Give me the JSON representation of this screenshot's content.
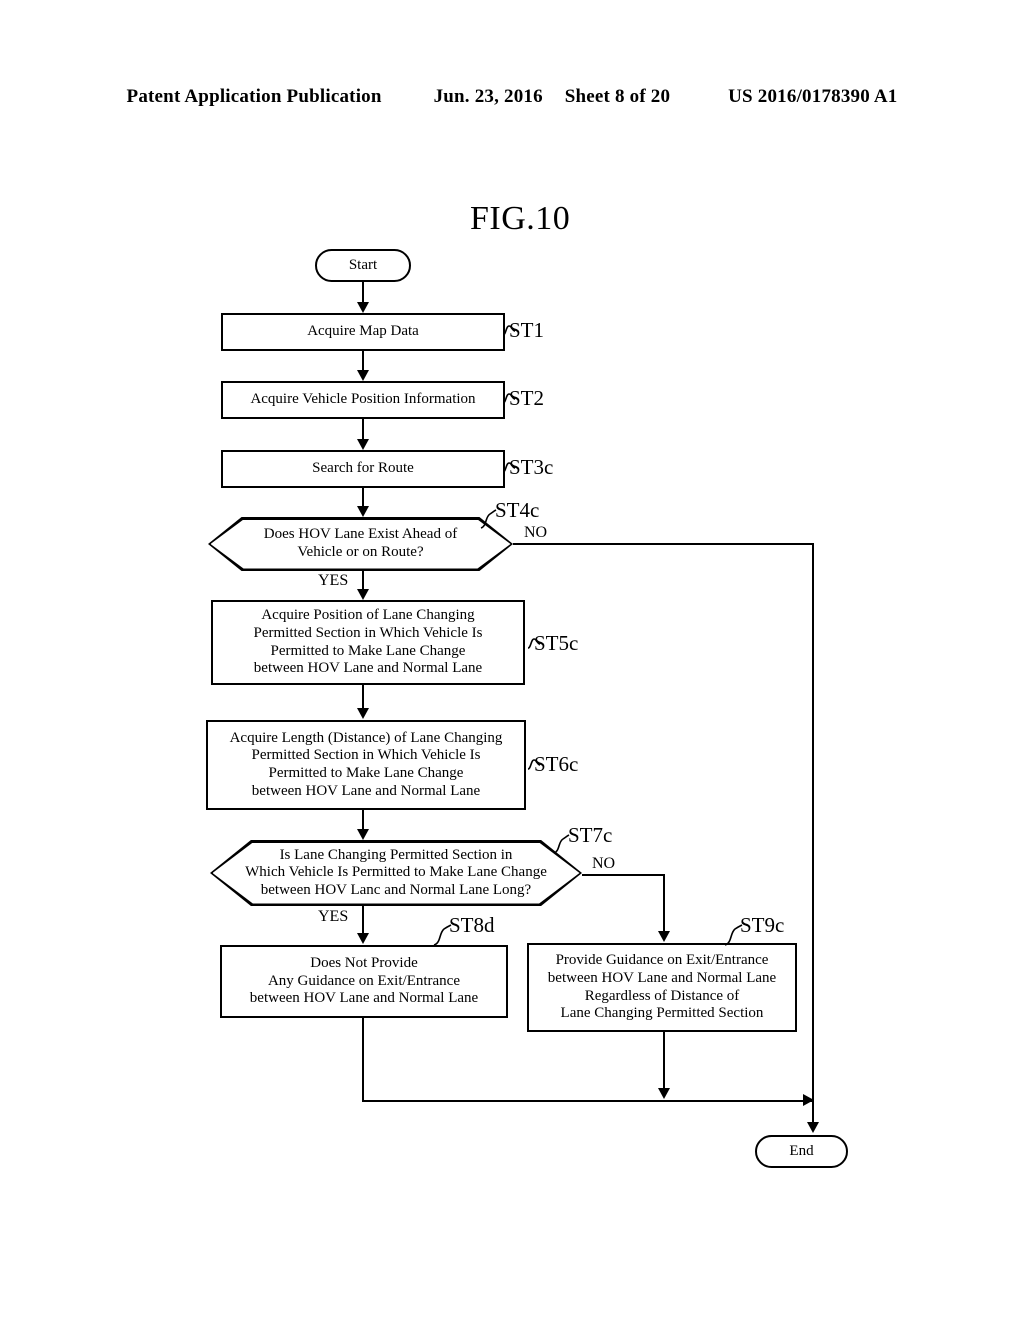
{
  "header": {
    "left": "Patent Application Publication",
    "date": "Jun. 23, 2016",
    "sheet": "Sheet 8 of 20",
    "pub_number": "US 2016/0178390 A1"
  },
  "figure": {
    "title": "FIG.10"
  },
  "flow": {
    "start": {
      "label": "Start"
    },
    "end": {
      "label": "End"
    },
    "steps": [
      {
        "id": "ST1",
        "tag": "ST1",
        "text": "Acquire Map Data"
      },
      {
        "id": "ST2",
        "tag": "ST2",
        "text": "Acquire Vehicle Position Information"
      },
      {
        "id": "ST3c",
        "tag": "ST3c",
        "text": "Search for Route"
      },
      {
        "id": "ST4c",
        "tag": "ST4c",
        "text": "Does HOV Lane Exist Ahead of\nVehicle or on Route?"
      },
      {
        "id": "ST5c",
        "tag": "ST5c",
        "text": "Acquire Position of Lane Changing\nPermitted Section in Which Vehicle Is\nPermitted to Make Lane Change\nbetween HOV Lane and Normal Lane"
      },
      {
        "id": "ST6c",
        "tag": "ST6c",
        "text": "Acquire Length (Distance) of Lane Changing\nPermitted Section in Which Vehicle Is\nPermitted to Make Lane Change\nbetween HOV Lane and Normal Lane"
      },
      {
        "id": "ST7c",
        "tag": "ST7c",
        "text": "Is Lane Changing Permitted Section in\nWhich Vehicle Is Permitted to Make Lane Change\nbetween HOV Lanc and Normal Lane Long?"
      },
      {
        "id": "ST8d",
        "tag": "ST8d",
        "text": "Does Not Provide\nAny Guidance on Exit/Entrance\nbetween HOV Lane and Normal Lane"
      },
      {
        "id": "ST9c",
        "tag": "ST9c",
        "text": "Provide Guidance on Exit/Entrance\nbetween HOV Lane and Normal Lane\nRegardless of Distance of\nLane Changing Permitted Section"
      }
    ],
    "branches": {
      "st4c_no": "NO",
      "st4c_yes": "YES",
      "st7c_no": "NO",
      "st7c_yes": "YES"
    }
  }
}
